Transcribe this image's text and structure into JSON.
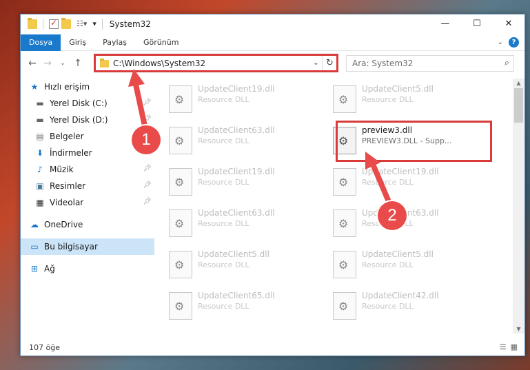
{
  "window": {
    "title": "System32"
  },
  "ribbon": {
    "tabs": [
      "Dosya",
      "Giriş",
      "Paylaş",
      "Görünüm"
    ]
  },
  "address": {
    "path": "C:\\Windows\\System32"
  },
  "search": {
    "placeholder": "Ara: System32"
  },
  "sidebar": {
    "quick_access": "Hızlı erişim",
    "items": [
      "Yerel Disk (C:)",
      "Yerel Disk (D:)",
      "Belgeler",
      "İndirmeler",
      "Müzik",
      "Resimler",
      "Videolar"
    ],
    "onedrive": "OneDrive",
    "this_pc": "Bu bilgisayar",
    "network": "Ağ"
  },
  "files": [
    {
      "name": "UpdateClient19.dll",
      "desc": "Resource DLL"
    },
    {
      "name": "UpdateClient5.dll",
      "desc": "Resource DLL"
    },
    {
      "name": "UpdateClient63.dll",
      "desc": "Resource DLL"
    },
    {
      "name": "preview3.dll",
      "desc": "PREVIEW3.DLL - Supp..."
    },
    {
      "name": "UpdateClient19.dll",
      "desc": "Resource DLL"
    },
    {
      "name": "UpdateClient19.dll",
      "desc": "Resource DLL"
    },
    {
      "name": "UpdateClient63.dll",
      "desc": "Resource DLL"
    },
    {
      "name": "UpdateClient63.dll",
      "desc": "Resource DLL"
    },
    {
      "name": "UpdateClient5.dll",
      "desc": "Resource DLL"
    },
    {
      "name": "UpdateClient5.dll",
      "desc": "Resource DLL"
    },
    {
      "name": "UpdateClient65.dll",
      "desc": "Resource DLL"
    },
    {
      "name": "UpdateClient42.dll",
      "desc": "Resource DLL"
    }
  ],
  "status": {
    "count": "107 öğe"
  },
  "callouts": [
    "1",
    "2"
  ],
  "colors": {
    "accent": "#1979ca",
    "highlight": "#d93a3a",
    "selected": "#cce4f7"
  }
}
